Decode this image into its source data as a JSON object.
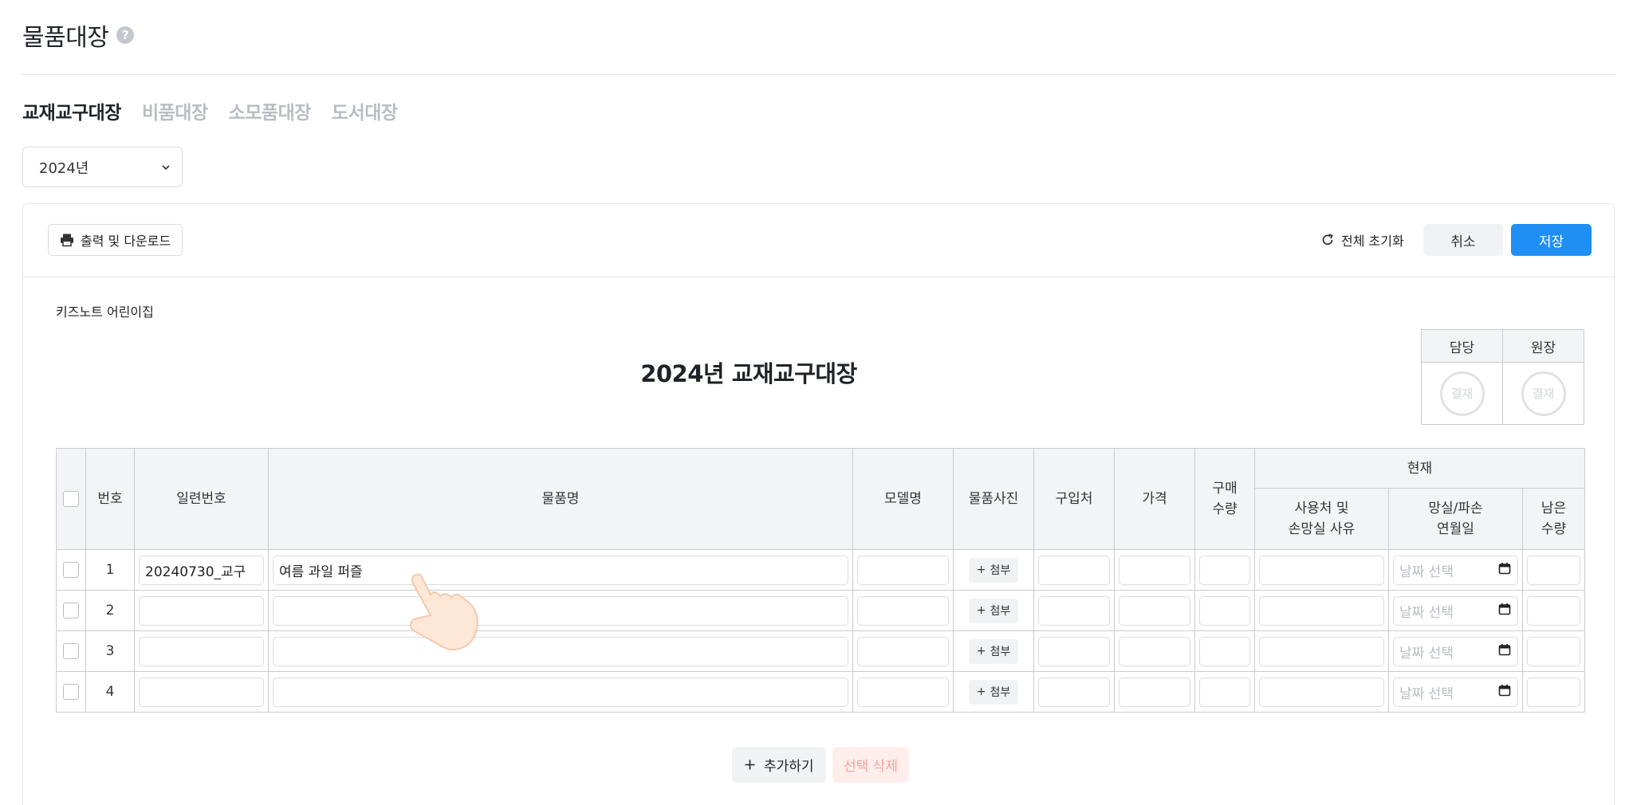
{
  "page": {
    "title": "물품대장"
  },
  "tabs": [
    {
      "label": "교재교구대장",
      "active": true
    },
    {
      "label": "비품대장",
      "active": false
    },
    {
      "label": "소모품대장",
      "active": false
    },
    {
      "label": "도서대장",
      "active": false
    }
  ],
  "year_select": {
    "value": "2024년"
  },
  "toolbar": {
    "print_label": "출력 및 다운로드",
    "reset_label": "전체 초기화",
    "cancel_label": "취소",
    "save_label": "저장"
  },
  "document": {
    "org_name": "키즈노트 어린이집",
    "title": "2024년 교재교구대장",
    "approval": {
      "headers": [
        "담당",
        "원장"
      ],
      "stamp_label": "결재"
    }
  },
  "table": {
    "headers": {
      "no": "번호",
      "serial": "일련번호",
      "item_name": "물품명",
      "model": "모델명",
      "photo": "물품사진",
      "vendor": "구입처",
      "price": "가격",
      "purchase_qty_1": "구매",
      "purchase_qty_2": "수량",
      "current": "현재",
      "usage_1": "사용처 및",
      "usage_2": "손망실 사유",
      "loss_date_1": "망실/파손",
      "loss_date_2": "연월일",
      "remaining_1": "남은",
      "remaining_2": "수량"
    },
    "attach_label": "첨부",
    "date_placeholder": "날짜 선택",
    "rows": [
      {
        "no": "1",
        "serial": "20240730_교구",
        "item_name": "여름 과일 퍼즐"
      },
      {
        "no": "2",
        "serial": "",
        "item_name": ""
      },
      {
        "no": "3",
        "serial": "",
        "item_name": ""
      },
      {
        "no": "4",
        "serial": "",
        "item_name": ""
      }
    ]
  },
  "actions": {
    "add_label": "추가하기",
    "delete_label": "선택 삭제"
  },
  "colors": {
    "primary": "#1f8ff5",
    "border": "#c9ccd0",
    "header_bg": "#f3f4f6",
    "danger_text": "#f3a59c"
  }
}
